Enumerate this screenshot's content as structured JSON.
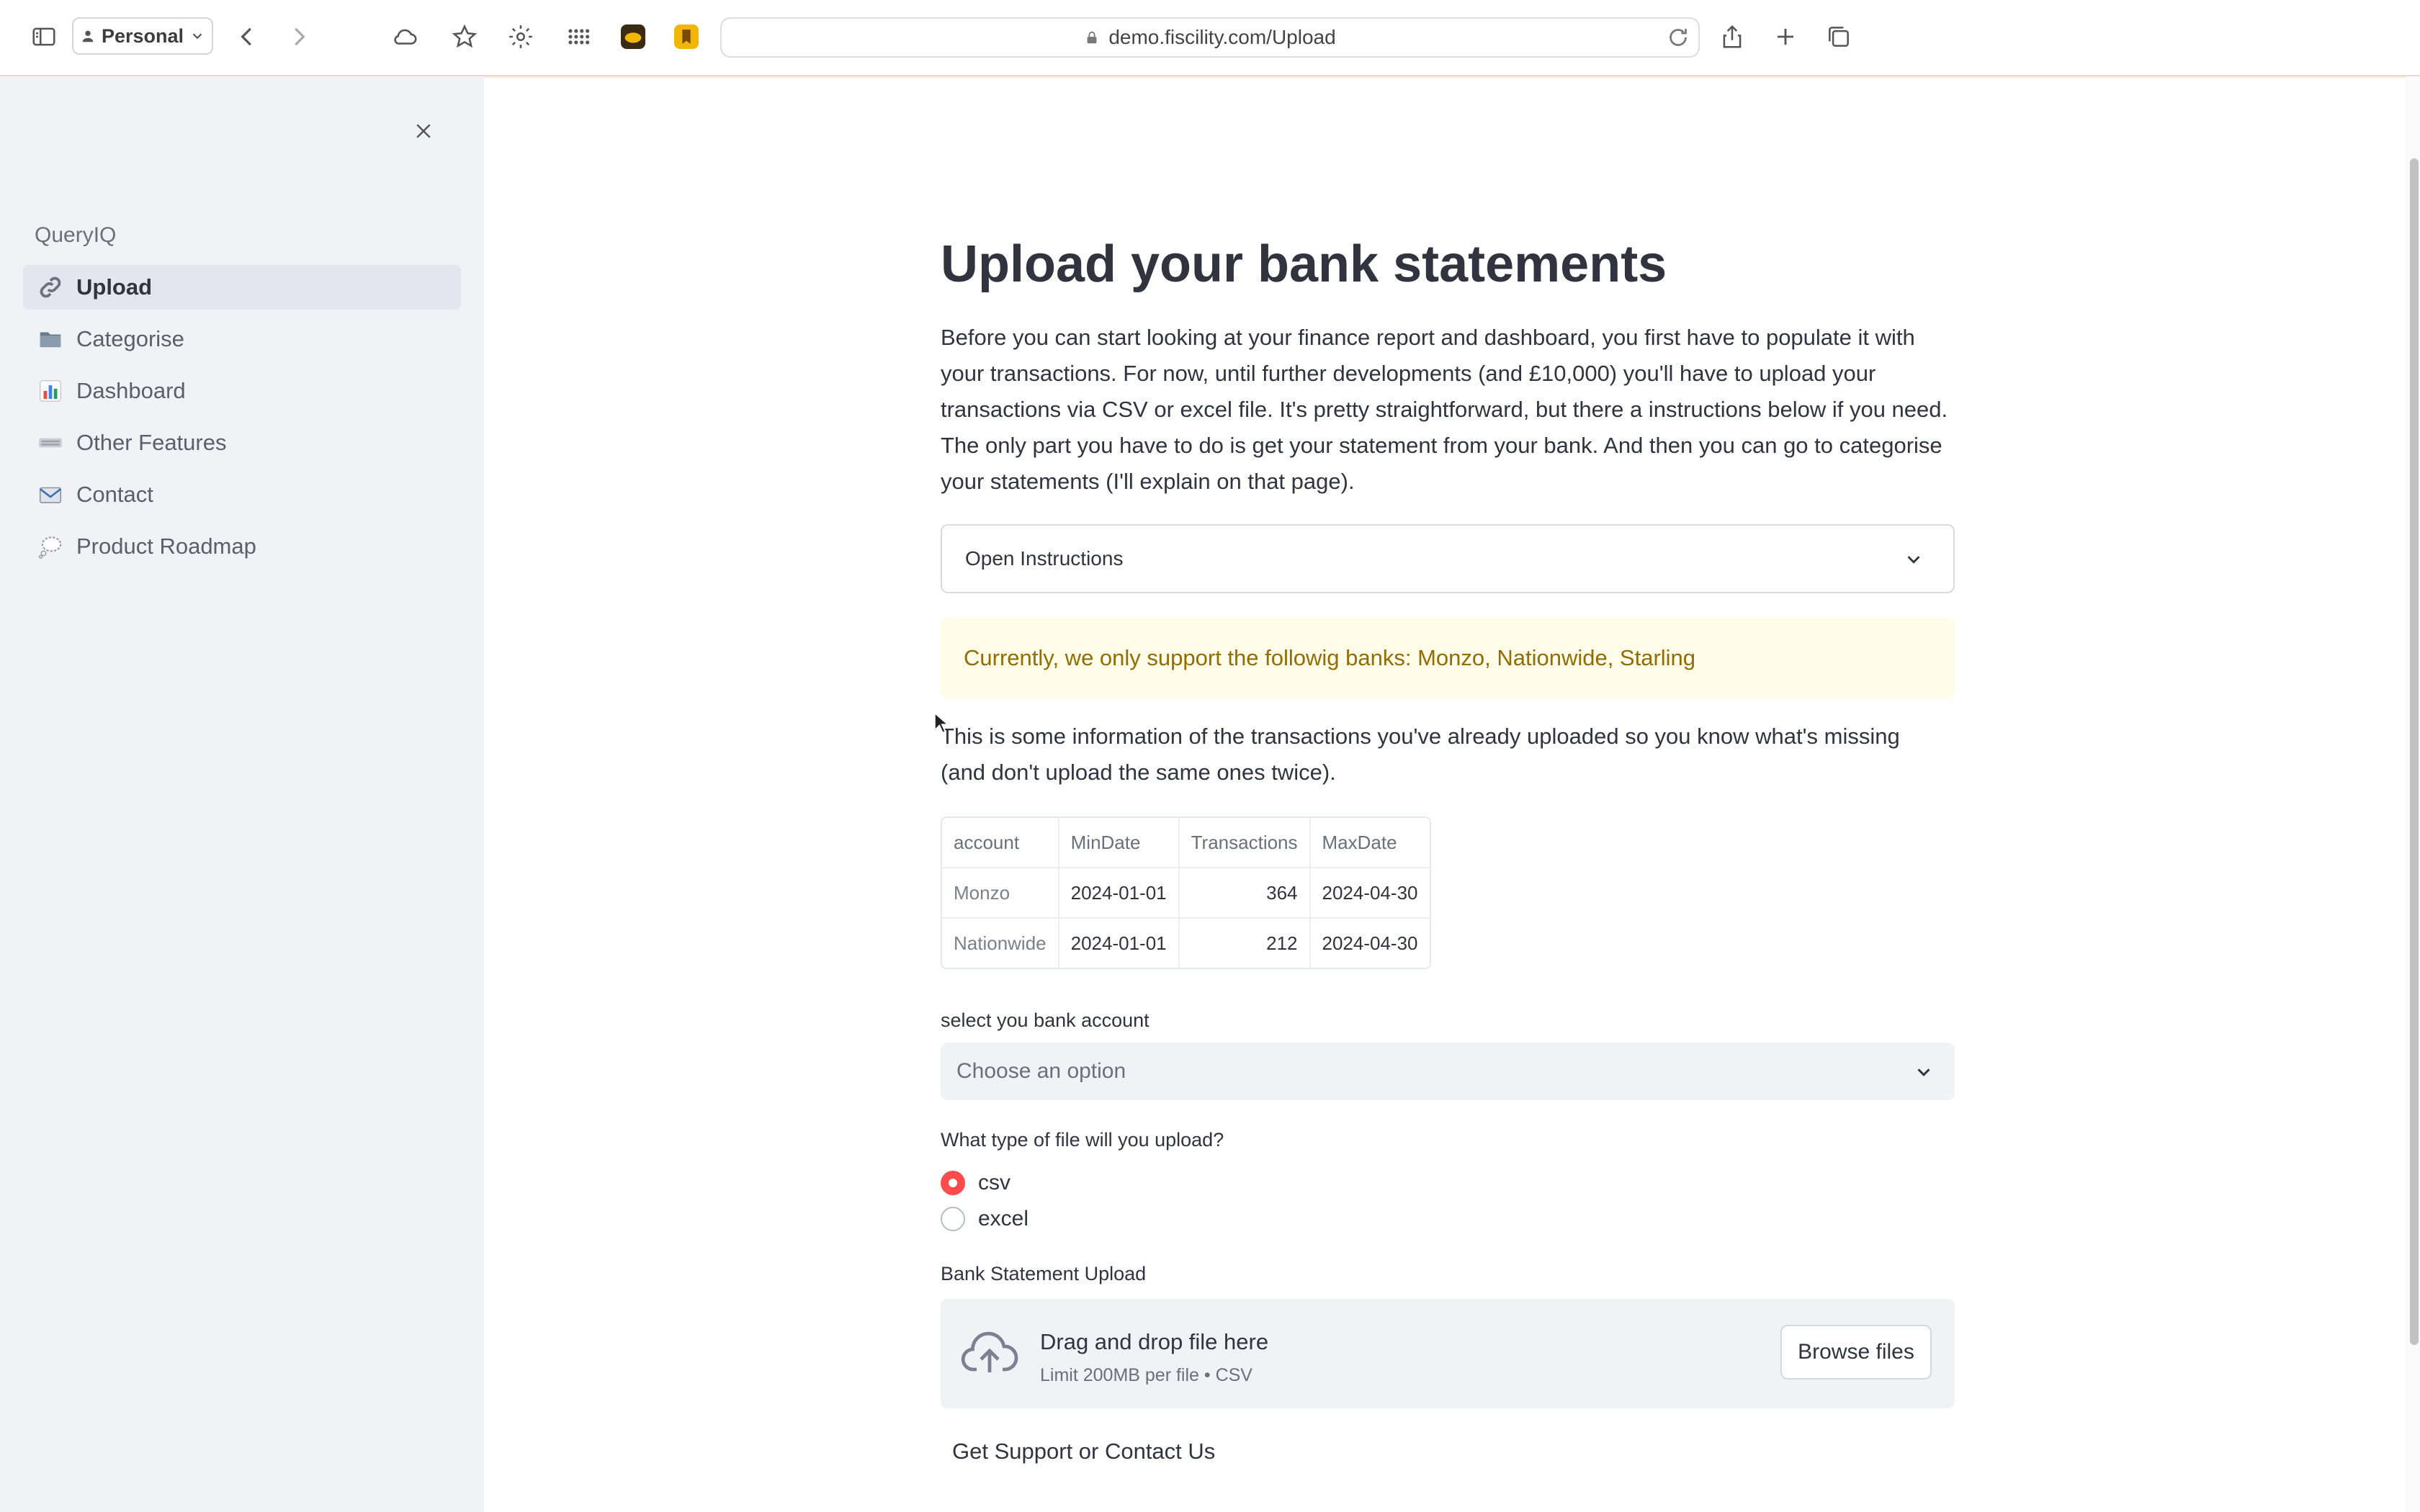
{
  "browser": {
    "profile_label": "Personal",
    "url": "demo.fiscility.com/Upload"
  },
  "sidebar": {
    "app_name": "QueryIQ",
    "items": [
      {
        "label": "Upload",
        "icon": "link-icon",
        "active": true
      },
      {
        "label": "Categorise",
        "icon": "folder-icon",
        "active": false
      },
      {
        "label": "Dashboard",
        "icon": "bar-chart-icon",
        "active": false
      },
      {
        "label": "Other Features",
        "icon": "keyboard-icon",
        "active": false
      },
      {
        "label": "Contact",
        "icon": "envelope-icon",
        "active": false
      },
      {
        "label": "Product Roadmap",
        "icon": "thought-bubble-icon",
        "active": false
      }
    ]
  },
  "main": {
    "title": "Upload your bank statements",
    "intro": "Before you can start looking at your finance report and dashboard, you first have to populate it with your transactions. For now, until further developments (and £10,000) you'll have to upload your transactions via CSV or excel file. It's pretty straightforward, but there a instructions below if you need. The only part you have to do is get your statement from your bank. And then you can go to categorise your statements (I'll explain on that page).",
    "expander_label": "Open Instructions",
    "warning": "Currently, we only support the followig banks: Monzo, Nationwide, Starling",
    "info_text": "This is some information of the transactions you've already uploaded so you know what's missing (and don't upload the same ones twice).",
    "table": {
      "columns": [
        "account",
        "MinDate",
        "Transactions",
        "MaxDate"
      ],
      "rows": [
        [
          "Monzo",
          "2024-01-01",
          "364",
          "2024-04-30"
        ],
        [
          "Nationwide",
          "2024-01-01",
          "212",
          "2024-04-30"
        ]
      ]
    },
    "account_select": {
      "label": "select you bank account",
      "placeholder": "Choose an option"
    },
    "file_type": {
      "label": "What type of file will you upload?",
      "options": [
        "csv",
        "excel"
      ],
      "selected": "csv"
    },
    "uploader": {
      "label": "Bank Statement Upload",
      "drag_text": "Drag and drop file here",
      "limit_text": "Limit 200MB per file • CSV",
      "browse_label": "Browse files"
    },
    "support_link": "Get Support or Contact Us"
  },
  "colors": {
    "accent": "#ff4b4b",
    "sidebar_bg": "#f0f2f6",
    "warning_bg": "#fffce7",
    "warning_text": "#926c05"
  }
}
